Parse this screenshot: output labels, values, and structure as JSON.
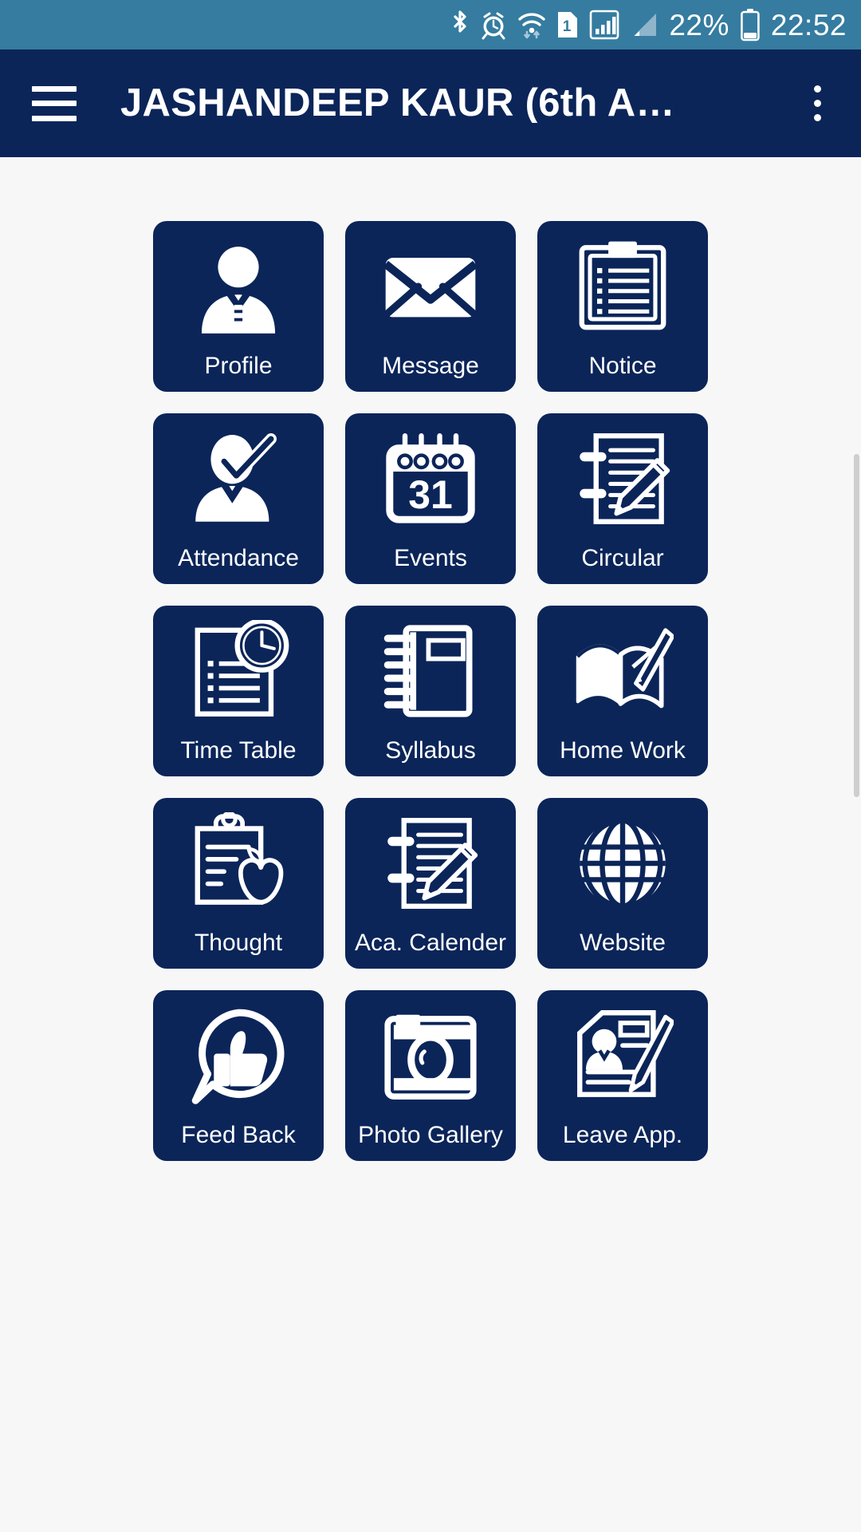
{
  "status_bar": {
    "background_color": "#357ca0",
    "icons": [
      "bluetooth-icon",
      "alarm-icon",
      "wifi-icon",
      "sim-1-icon",
      "signal-bars-icon",
      "signal-triangle-icon"
    ],
    "battery_percent": "22%",
    "battery_icon": "battery-icon",
    "time": "22:52"
  },
  "app_bar": {
    "background_color": "#0b2559",
    "menu_icon": "hamburger-menu-icon",
    "title": "JASHANDEEP KAUR (6th A…",
    "overflow_icon": "more-vertical-icon"
  },
  "theme": {
    "tile_color": "#0b2559",
    "page_background": "#f7f7f7",
    "icon_color": "#ffffff"
  },
  "grid": {
    "columns": 3,
    "tiles": [
      {
        "label": "Profile",
        "icon": "user-profile-icon"
      },
      {
        "label": "Message",
        "icon": "envelope-icon"
      },
      {
        "label": "Notice",
        "icon": "clipboard-list-icon"
      },
      {
        "label": "Attendance",
        "icon": "user-check-icon"
      },
      {
        "label": "Events",
        "icon": "calendar-31-icon"
      },
      {
        "label": "Circular",
        "icon": "notebook-pencil-icon"
      },
      {
        "label": "Time Table",
        "icon": "document-clock-icon"
      },
      {
        "label": "Syllabus",
        "icon": "spiral-book-icon"
      },
      {
        "label": "Home Work",
        "icon": "open-book-pencil-icon"
      },
      {
        "label": "Thought",
        "icon": "clipboard-apple-icon"
      },
      {
        "label": "Aca. Calender",
        "icon": "notebook-pencil-icon"
      },
      {
        "label": "Website",
        "icon": "globe-icon"
      },
      {
        "label": "Feed Back",
        "icon": "thumbs-up-bubble-icon"
      },
      {
        "label": "Photo Gallery",
        "icon": "camera-icon"
      },
      {
        "label": "Leave App.",
        "icon": "leave-application-icon"
      }
    ]
  },
  "scrollbar": {
    "present": true
  }
}
